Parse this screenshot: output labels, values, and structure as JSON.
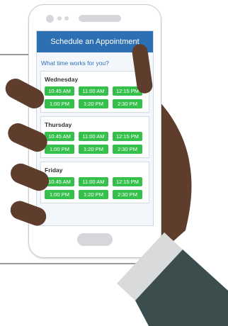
{
  "header": {
    "title": "Schedule an Appointment"
  },
  "prompt": "What time works for you?",
  "days": [
    {
      "name": "Wednesday",
      "slots": [
        "10:45 AM",
        "11:00 AM",
        "12:15 PM",
        "1:00 PM",
        "1:20 PM",
        "2:30 PM"
      ]
    },
    {
      "name": "Thursday",
      "slots": [
        "10:45 AM",
        "11:00 AM",
        "12:15 PM",
        "1:00 PM",
        "1:20 PM",
        "2:30 PM"
      ]
    },
    {
      "name": "Friday",
      "slots": [
        "10:45 AM",
        "11:00 AM",
        "12:15 PM",
        "1:00 PM",
        "1:20 PM",
        "2:30 PM"
      ]
    }
  ],
  "colors": {
    "header_blue": "#2d6fb3",
    "slot_green": "#34c04a",
    "skin": "#5e3d2d",
    "sleeve": "#3c4d4e",
    "cuff": "#d8dadb"
  }
}
